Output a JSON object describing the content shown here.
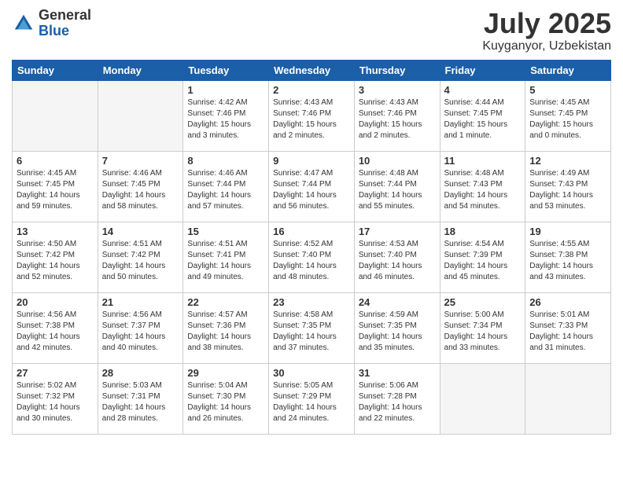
{
  "logo": {
    "general": "General",
    "blue": "Blue"
  },
  "title": {
    "month": "July 2025",
    "location": "Kuyganyor, Uzbekistan"
  },
  "headers": [
    "Sunday",
    "Monday",
    "Tuesday",
    "Wednesday",
    "Thursday",
    "Friday",
    "Saturday"
  ],
  "weeks": [
    [
      {
        "day": "",
        "info": ""
      },
      {
        "day": "",
        "info": ""
      },
      {
        "day": "1",
        "sunrise": "Sunrise: 4:42 AM",
        "sunset": "Sunset: 7:46 PM",
        "daylight": "Daylight: 15 hours and 3 minutes."
      },
      {
        "day": "2",
        "sunrise": "Sunrise: 4:43 AM",
        "sunset": "Sunset: 7:46 PM",
        "daylight": "Daylight: 15 hours and 2 minutes."
      },
      {
        "day": "3",
        "sunrise": "Sunrise: 4:43 AM",
        "sunset": "Sunset: 7:46 PM",
        "daylight": "Daylight: 15 hours and 2 minutes."
      },
      {
        "day": "4",
        "sunrise": "Sunrise: 4:44 AM",
        "sunset": "Sunset: 7:45 PM",
        "daylight": "Daylight: 15 hours and 1 minute."
      },
      {
        "day": "5",
        "sunrise": "Sunrise: 4:45 AM",
        "sunset": "Sunset: 7:45 PM",
        "daylight": "Daylight: 15 hours and 0 minutes."
      }
    ],
    [
      {
        "day": "6",
        "sunrise": "Sunrise: 4:45 AM",
        "sunset": "Sunset: 7:45 PM",
        "daylight": "Daylight: 14 hours and 59 minutes."
      },
      {
        "day": "7",
        "sunrise": "Sunrise: 4:46 AM",
        "sunset": "Sunset: 7:45 PM",
        "daylight": "Daylight: 14 hours and 58 minutes."
      },
      {
        "day": "8",
        "sunrise": "Sunrise: 4:46 AM",
        "sunset": "Sunset: 7:44 PM",
        "daylight": "Daylight: 14 hours and 57 minutes."
      },
      {
        "day": "9",
        "sunrise": "Sunrise: 4:47 AM",
        "sunset": "Sunset: 7:44 PM",
        "daylight": "Daylight: 14 hours and 56 minutes."
      },
      {
        "day": "10",
        "sunrise": "Sunrise: 4:48 AM",
        "sunset": "Sunset: 7:44 PM",
        "daylight": "Daylight: 14 hours and 55 minutes."
      },
      {
        "day": "11",
        "sunrise": "Sunrise: 4:48 AM",
        "sunset": "Sunset: 7:43 PM",
        "daylight": "Daylight: 14 hours and 54 minutes."
      },
      {
        "day": "12",
        "sunrise": "Sunrise: 4:49 AM",
        "sunset": "Sunset: 7:43 PM",
        "daylight": "Daylight: 14 hours and 53 minutes."
      }
    ],
    [
      {
        "day": "13",
        "sunrise": "Sunrise: 4:50 AM",
        "sunset": "Sunset: 7:42 PM",
        "daylight": "Daylight: 14 hours and 52 minutes."
      },
      {
        "day": "14",
        "sunrise": "Sunrise: 4:51 AM",
        "sunset": "Sunset: 7:42 PM",
        "daylight": "Daylight: 14 hours and 50 minutes."
      },
      {
        "day": "15",
        "sunrise": "Sunrise: 4:51 AM",
        "sunset": "Sunset: 7:41 PM",
        "daylight": "Daylight: 14 hours and 49 minutes."
      },
      {
        "day": "16",
        "sunrise": "Sunrise: 4:52 AM",
        "sunset": "Sunset: 7:40 PM",
        "daylight": "Daylight: 14 hours and 48 minutes."
      },
      {
        "day": "17",
        "sunrise": "Sunrise: 4:53 AM",
        "sunset": "Sunset: 7:40 PM",
        "daylight": "Daylight: 14 hours and 46 minutes."
      },
      {
        "day": "18",
        "sunrise": "Sunrise: 4:54 AM",
        "sunset": "Sunset: 7:39 PM",
        "daylight": "Daylight: 14 hours and 45 minutes."
      },
      {
        "day": "19",
        "sunrise": "Sunrise: 4:55 AM",
        "sunset": "Sunset: 7:38 PM",
        "daylight": "Daylight: 14 hours and 43 minutes."
      }
    ],
    [
      {
        "day": "20",
        "sunrise": "Sunrise: 4:56 AM",
        "sunset": "Sunset: 7:38 PM",
        "daylight": "Daylight: 14 hours and 42 minutes."
      },
      {
        "day": "21",
        "sunrise": "Sunrise: 4:56 AM",
        "sunset": "Sunset: 7:37 PM",
        "daylight": "Daylight: 14 hours and 40 minutes."
      },
      {
        "day": "22",
        "sunrise": "Sunrise: 4:57 AM",
        "sunset": "Sunset: 7:36 PM",
        "daylight": "Daylight: 14 hours and 38 minutes."
      },
      {
        "day": "23",
        "sunrise": "Sunrise: 4:58 AM",
        "sunset": "Sunset: 7:35 PM",
        "daylight": "Daylight: 14 hours and 37 minutes."
      },
      {
        "day": "24",
        "sunrise": "Sunrise: 4:59 AM",
        "sunset": "Sunset: 7:35 PM",
        "daylight": "Daylight: 14 hours and 35 minutes."
      },
      {
        "day": "25",
        "sunrise": "Sunrise: 5:00 AM",
        "sunset": "Sunset: 7:34 PM",
        "daylight": "Daylight: 14 hours and 33 minutes."
      },
      {
        "day": "26",
        "sunrise": "Sunrise: 5:01 AM",
        "sunset": "Sunset: 7:33 PM",
        "daylight": "Daylight: 14 hours and 31 minutes."
      }
    ],
    [
      {
        "day": "27",
        "sunrise": "Sunrise: 5:02 AM",
        "sunset": "Sunset: 7:32 PM",
        "daylight": "Daylight: 14 hours and 30 minutes."
      },
      {
        "day": "28",
        "sunrise": "Sunrise: 5:03 AM",
        "sunset": "Sunset: 7:31 PM",
        "daylight": "Daylight: 14 hours and 28 minutes."
      },
      {
        "day": "29",
        "sunrise": "Sunrise: 5:04 AM",
        "sunset": "Sunset: 7:30 PM",
        "daylight": "Daylight: 14 hours and 26 minutes."
      },
      {
        "day": "30",
        "sunrise": "Sunrise: 5:05 AM",
        "sunset": "Sunset: 7:29 PM",
        "daylight": "Daylight: 14 hours and 24 minutes."
      },
      {
        "day": "31",
        "sunrise": "Sunrise: 5:06 AM",
        "sunset": "Sunset: 7:28 PM",
        "daylight": "Daylight: 14 hours and 22 minutes."
      },
      {
        "day": "",
        "info": ""
      },
      {
        "day": "",
        "info": ""
      }
    ]
  ]
}
